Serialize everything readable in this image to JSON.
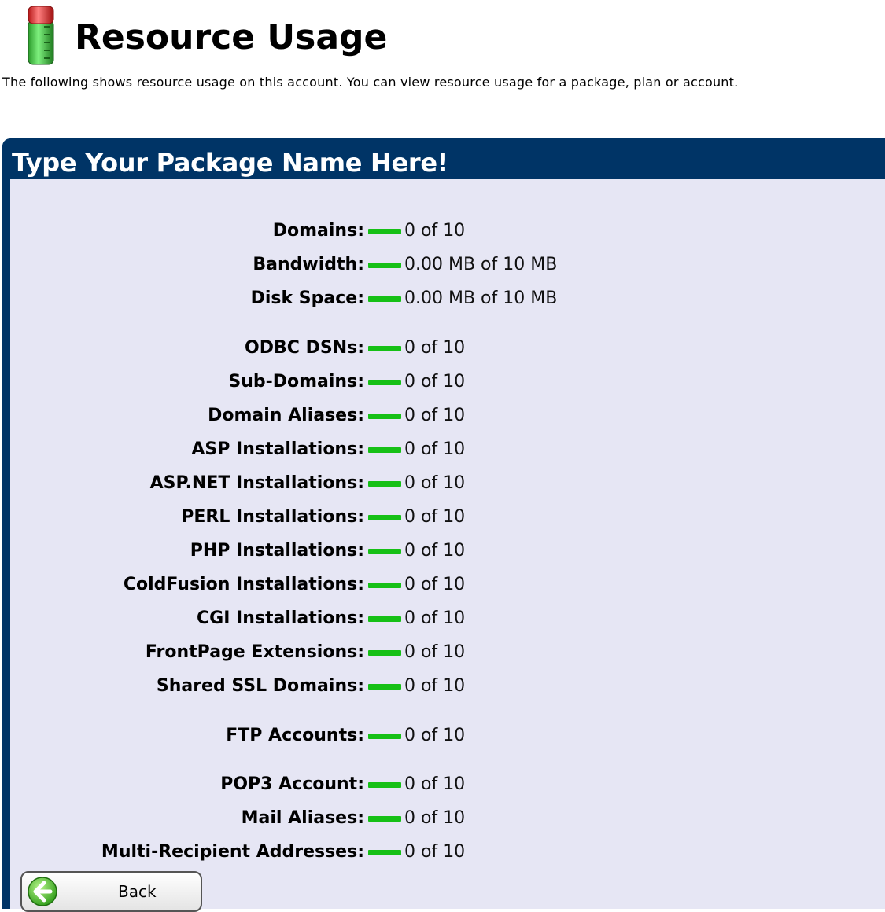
{
  "header": {
    "title": "Resource Usage",
    "description": "The following shows resource usage on this account. You can view resource usage for a package, plan or account."
  },
  "package": {
    "name": "Type Your Package Name Here!"
  },
  "usage": [
    {
      "label": "Domains:",
      "value": "0 of 10"
    },
    {
      "label": "Bandwidth:",
      "value": "0.00 MB of 10 MB"
    },
    {
      "label": "Disk Space:",
      "value": "0.00 MB of 10 MB"
    },
    {
      "label": "ODBC DSNs:",
      "value": "0 of 10"
    },
    {
      "label": "Sub-Domains:",
      "value": "0 of 10"
    },
    {
      "label": "Domain Aliases:",
      "value": "0 of 10"
    },
    {
      "label": "ASP Installations:",
      "value": "0 of 10"
    },
    {
      "label": "ASP.NET Installations:",
      "value": "0 of 10"
    },
    {
      "label": "PERL Installations:",
      "value": "0 of 10"
    },
    {
      "label": "PHP Installations:",
      "value": "0 of 10"
    },
    {
      "label": "ColdFusion Installations:",
      "value": "0 of 10"
    },
    {
      "label": "CGI Installations:",
      "value": "0 of 10"
    },
    {
      "label": "FrontPage Extensions:",
      "value": "0 of 10"
    },
    {
      "label": "Shared SSL Domains:",
      "value": "0 of 10"
    },
    {
      "label": "FTP Accounts:",
      "value": "0 of 10"
    },
    {
      "label": "POP3 Account:",
      "value": "0 of 10"
    },
    {
      "label": "Mail Aliases:",
      "value": "0 of 10"
    },
    {
      "label": "Multi-Recipient Addresses:",
      "value": "0 of 10"
    }
  ],
  "buttons": {
    "back_label": "Back"
  },
  "icons": {
    "header_icon": "resource-meter-icon",
    "back_icon": "back-arrow-icon"
  },
  "colors": {
    "panel_header": "#003466",
    "panel_body": "#e6e6f4",
    "usage_bar": "#16c016"
  }
}
